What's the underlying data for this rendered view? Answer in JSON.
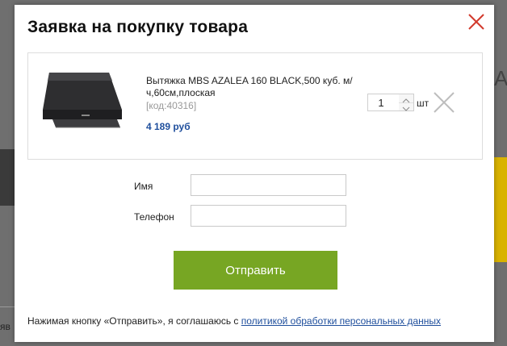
{
  "modal": {
    "title": "Заявка на покупку товара",
    "close_icon": "close-icon"
  },
  "product": {
    "name": "Вытяжка MBS AZALEA 160 BLACK,500 куб. м/ч,60см,плоская",
    "code": "[код:40316]",
    "price": "4 189 руб",
    "quantity": "1",
    "unit": "шт",
    "remove_icon": "remove-x-icon",
    "image_icon": "range-hood-image"
  },
  "form": {
    "name_label": "Имя",
    "name_value": "",
    "phone_label": "Телефон",
    "phone_value": "",
    "submit_label": "Отправить"
  },
  "consent": {
    "text": "Нажимая кнопку «Отправить», я соглашаюсь с ",
    "link": "политикой обработки персональных данных"
  },
  "background": {
    "left_text": "яв",
    "right_letter": "А"
  },
  "colors": {
    "accent_green": "#77a623",
    "close_red": "#d23a2c",
    "price_blue": "#1e4e9c",
    "code_gray": "#999999"
  }
}
